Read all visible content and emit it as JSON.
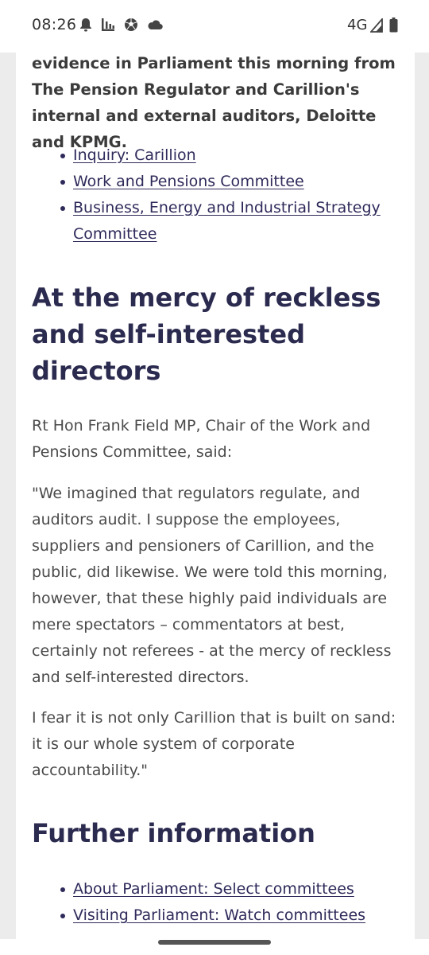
{
  "status_bar": {
    "time": "08:26",
    "network": "4G",
    "left_icons": [
      "notification-bell-icon",
      "bar-chart-icon",
      "soccer-ball-icon",
      "cloud-icon"
    ],
    "right_icons": [
      "signal-icon",
      "battery-icon"
    ]
  },
  "article": {
    "intro": "evidence in Parliament this morning from The Pension Regulator and Carillion's internal and external auditors, Deloitte and KPMG.",
    "links_top": [
      {
        "label": "Inquiry: Carillion"
      },
      {
        "label": "Work and Pensions Committee"
      },
      {
        "label": "Business, Energy and Industrial Strategy Committee"
      }
    ],
    "heading_1": "At the mercy of reckless and self-interested directors",
    "speaker": "Rt Hon Frank Field MP, Chair of the Work and Pensions Committee, said:",
    "quote_1": "\"We imagined that regulators regulate, and auditors audit. I suppose the employees, suppliers and pensioners of Carillion, and the public, did likewise. We were told this morning, however, that these highly paid individuals are mere spectators – commentators at best, certainly not referees - at the mercy of reckless and self-interested directors.",
    "quote_2": "I fear it is not only Carillion that is built on sand: it is our whole system of corporate accountability.\"",
    "heading_2": "Further information",
    "links_bottom": [
      {
        "label": "About Parliament: Select committees"
      },
      {
        "label": "Visiting Parliament: Watch committees"
      }
    ]
  }
}
